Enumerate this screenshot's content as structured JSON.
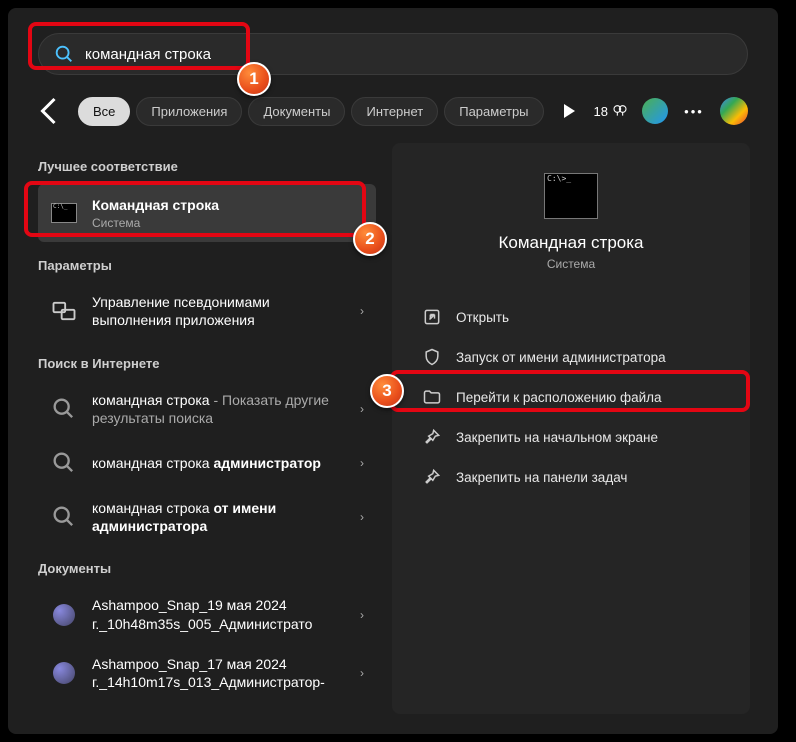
{
  "search": {
    "value": "командная строка"
  },
  "tabs": {
    "all": "Все",
    "apps": "Приложения",
    "docs": "Документы",
    "web": "Интернет",
    "settings": "Параметры"
  },
  "rewards": "18",
  "sections": {
    "best": "Лучшее соответствие",
    "settings": "Параметры",
    "web": "Поиск в Интернете",
    "docs": "Документы"
  },
  "best_match": {
    "title": "Командная строка",
    "sub": "Система"
  },
  "settings_item": {
    "title": "Управление псевдонимами выполнения приложения"
  },
  "web_items": [
    {
      "plain": "командная строка",
      "suffix": " - Показать другие результаты поиска",
      "bold": ""
    },
    {
      "plain": "командная строка ",
      "bold": "администратор",
      "suffix": ""
    },
    {
      "plain": "командная строка ",
      "bold": "от имени администратора",
      "suffix": ""
    }
  ],
  "doc_items": [
    {
      "title": "Ashampoo_Snap_19 мая 2024 г._10h48m35s_005_Администрато"
    },
    {
      "title": "Ashampoo_Snap_17 мая 2024 г._14h10m17s_013_Администратор-"
    }
  ],
  "preview": {
    "title": "Командная строка",
    "sub": "Система"
  },
  "actions": {
    "open": "Открыть",
    "admin": "Запуск от имени администратора",
    "location": "Перейти к расположению файла",
    "pin_start": "Закрепить на начальном экране",
    "pin_taskbar": "Закрепить на панели задач"
  },
  "callouts": {
    "c1": "1",
    "c2": "2",
    "c3": "3"
  }
}
